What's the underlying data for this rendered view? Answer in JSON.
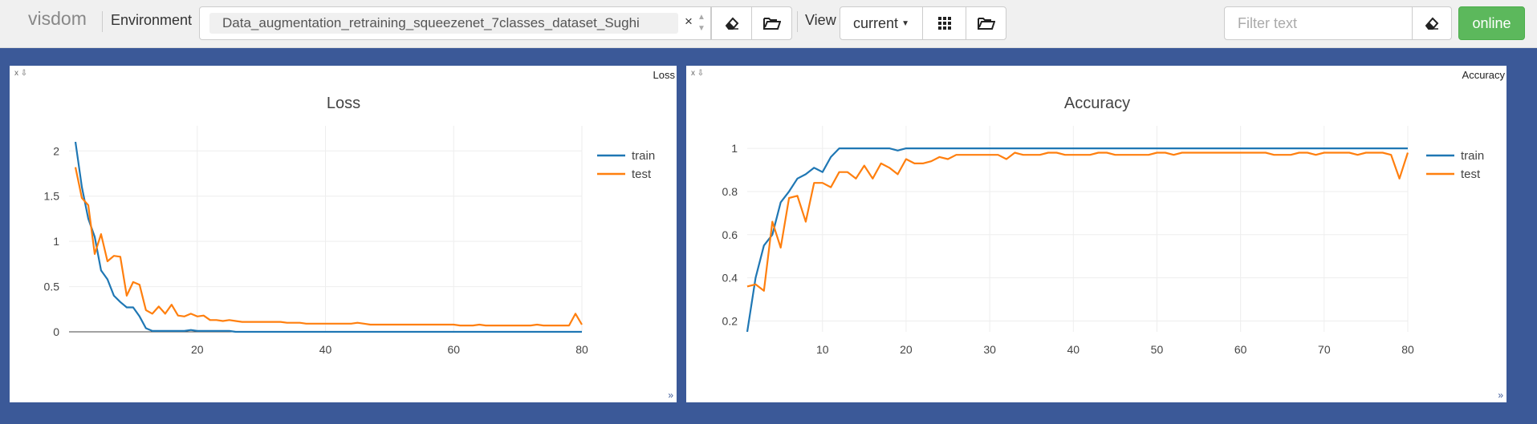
{
  "navbar": {
    "brand": "visdom",
    "environment_label": "Environment",
    "environment_value": "Data_augmentation_retraining_squeezenet_7classes_dataset_Sughi",
    "clear_symbol": "×",
    "view_label": "View",
    "view_value": "current",
    "filter_placeholder": "Filter text",
    "status": "online"
  },
  "panes": [
    {
      "name": "Loss",
      "ctrl": "x ⇩"
    },
    {
      "name": "Accuracy",
      "ctrl": "x ⇩"
    }
  ],
  "chart_data": [
    {
      "type": "line",
      "title": "Loss",
      "xlabel": "",
      "ylabel": "",
      "xlim": [
        0,
        80
      ],
      "ylim": [
        0,
        2.1
      ],
      "xticks": [
        20,
        40,
        60,
        80
      ],
      "yticks": [
        0,
        0.5,
        1,
        1.5,
        2
      ],
      "ytick_labels": [
        "0",
        "0.5",
        "1",
        "1.5",
        "2"
      ],
      "grid": true,
      "legend_position": "top-right",
      "x": [
        1,
        2,
        3,
        4,
        5,
        6,
        7,
        8,
        9,
        10,
        11,
        12,
        13,
        14,
        15,
        16,
        17,
        18,
        19,
        20,
        21,
        22,
        23,
        24,
        25,
        26,
        27,
        28,
        29,
        30,
        31,
        32,
        33,
        34,
        35,
        36,
        37,
        38,
        39,
        40,
        41,
        42,
        43,
        44,
        45,
        46,
        47,
        48,
        49,
        50,
        51,
        52,
        53,
        54,
        55,
        56,
        57,
        58,
        59,
        60,
        61,
        62,
        63,
        64,
        65,
        66,
        67,
        68,
        69,
        70,
        71,
        72,
        73,
        74,
        75,
        76,
        77,
        78,
        79,
        80
      ],
      "series": [
        {
          "name": "train",
          "color": "#1f77b4",
          "values": [
            2.1,
            1.6,
            1.25,
            1.05,
            0.68,
            0.58,
            0.4,
            0.33,
            0.27,
            0.27,
            0.17,
            0.04,
            0.01,
            0.01,
            0.01,
            0.01,
            0.01,
            0.01,
            0.02,
            0.01,
            0.01,
            0.01,
            0.01,
            0.01,
            0.01,
            0.0,
            0.0,
            0.0,
            0.0,
            0.0,
            0.0,
            0.0,
            0.0,
            0.0,
            0.0,
            0.0,
            0.0,
            0.0,
            0.0,
            0.0,
            0.0,
            0.0,
            0.0,
            0.0,
            0.0,
            0.0,
            0.0,
            0.0,
            0.0,
            0.0,
            0.0,
            0.0,
            0.0,
            0.0,
            0.0,
            0.0,
            0.0,
            0.0,
            0.0,
            0.0,
            0.0,
            0.0,
            0.0,
            0.0,
            0.0,
            0.0,
            0.0,
            0.0,
            0.0,
            0.0,
            0.0,
            0.0,
            0.0,
            0.0,
            0.0,
            0.0,
            0.0,
            0.0,
            0.0,
            0.0
          ]
        },
        {
          "name": "test",
          "color": "#ff7f0e",
          "values": [
            1.82,
            1.48,
            1.4,
            0.86,
            1.08,
            0.78,
            0.84,
            0.83,
            0.4,
            0.55,
            0.52,
            0.24,
            0.2,
            0.28,
            0.2,
            0.3,
            0.18,
            0.17,
            0.2,
            0.17,
            0.18,
            0.13,
            0.13,
            0.12,
            0.13,
            0.12,
            0.11,
            0.11,
            0.11,
            0.11,
            0.11,
            0.11,
            0.11,
            0.1,
            0.1,
            0.1,
            0.09,
            0.09,
            0.09,
            0.09,
            0.09,
            0.09,
            0.09,
            0.09,
            0.1,
            0.09,
            0.08,
            0.08,
            0.08,
            0.08,
            0.08,
            0.08,
            0.08,
            0.08,
            0.08,
            0.08,
            0.08,
            0.08,
            0.08,
            0.08,
            0.07,
            0.07,
            0.07,
            0.08,
            0.07,
            0.07,
            0.07,
            0.07,
            0.07,
            0.07,
            0.07,
            0.07,
            0.08,
            0.07,
            0.07,
            0.07,
            0.07,
            0.07,
            0.2,
            0.08
          ]
        }
      ]
    },
    {
      "type": "line",
      "title": "Accuracy",
      "xlabel": "",
      "ylabel": "",
      "xlim": [
        1,
        80
      ],
      "ylim": [
        0.15,
        1.03
      ],
      "xticks": [
        10,
        20,
        30,
        40,
        50,
        60,
        70,
        80
      ],
      "yticks": [
        0.2,
        0.4,
        0.6,
        0.8,
        1
      ],
      "ytick_labels": [
        "0.2",
        "0.4",
        "0.6",
        "0.8",
        "1"
      ],
      "grid": true,
      "legend_position": "top-right",
      "x": [
        1,
        2,
        3,
        4,
        5,
        6,
        7,
        8,
        9,
        10,
        11,
        12,
        13,
        14,
        15,
        16,
        17,
        18,
        19,
        20,
        21,
        22,
        23,
        24,
        25,
        26,
        27,
        28,
        29,
        30,
        31,
        32,
        33,
        34,
        35,
        36,
        37,
        38,
        39,
        40,
        41,
        42,
        43,
        44,
        45,
        46,
        47,
        48,
        49,
        50,
        51,
        52,
        53,
        54,
        55,
        56,
        57,
        58,
        59,
        60,
        61,
        62,
        63,
        64,
        65,
        66,
        67,
        68,
        69,
        70,
        71,
        72,
        73,
        74,
        75,
        76,
        77,
        78,
        79,
        80
      ],
      "series": [
        {
          "name": "train",
          "color": "#1f77b4",
          "values": [
            0.15,
            0.4,
            0.55,
            0.6,
            0.75,
            0.8,
            0.86,
            0.88,
            0.91,
            0.89,
            0.96,
            1.0,
            1.0,
            1.0,
            1.0,
            1.0,
            1.0,
            1.0,
            0.99,
            1.0,
            1.0,
            1.0,
            1.0,
            1.0,
            1.0,
            1.0,
            1.0,
            1.0,
            1.0,
            1.0,
            1.0,
            1.0,
            1.0,
            1.0,
            1.0,
            1.0,
            1.0,
            1.0,
            1.0,
            1.0,
            1.0,
            1.0,
            1.0,
            1.0,
            1.0,
            1.0,
            1.0,
            1.0,
            1.0,
            1.0,
            1.0,
            1.0,
            1.0,
            1.0,
            1.0,
            1.0,
            1.0,
            1.0,
            1.0,
            1.0,
            1.0,
            1.0,
            1.0,
            1.0,
            1.0,
            1.0,
            1.0,
            1.0,
            1.0,
            1.0,
            1.0,
            1.0,
            1.0,
            1.0,
            1.0,
            1.0,
            1.0,
            1.0,
            1.0,
            1.0
          ]
        },
        {
          "name": "test",
          "color": "#ff7f0e",
          "values": [
            0.36,
            0.37,
            0.34,
            0.66,
            0.54,
            0.77,
            0.78,
            0.66,
            0.84,
            0.84,
            0.82,
            0.89,
            0.89,
            0.86,
            0.92,
            0.86,
            0.93,
            0.91,
            0.88,
            0.95,
            0.93,
            0.93,
            0.94,
            0.96,
            0.95,
            0.97,
            0.97,
            0.97,
            0.97,
            0.97,
            0.97,
            0.95,
            0.98,
            0.97,
            0.97,
            0.97,
            0.98,
            0.98,
            0.97,
            0.97,
            0.97,
            0.97,
            0.98,
            0.98,
            0.97,
            0.97,
            0.97,
            0.97,
            0.97,
            0.98,
            0.98,
            0.97,
            0.98,
            0.98,
            0.98,
            0.98,
            0.98,
            0.98,
            0.98,
            0.98,
            0.98,
            0.98,
            0.98,
            0.97,
            0.97,
            0.97,
            0.98,
            0.98,
            0.97,
            0.98,
            0.98,
            0.98,
            0.98,
            0.97,
            0.98,
            0.98,
            0.98,
            0.97,
            0.86,
            0.98
          ]
        }
      ]
    }
  ]
}
